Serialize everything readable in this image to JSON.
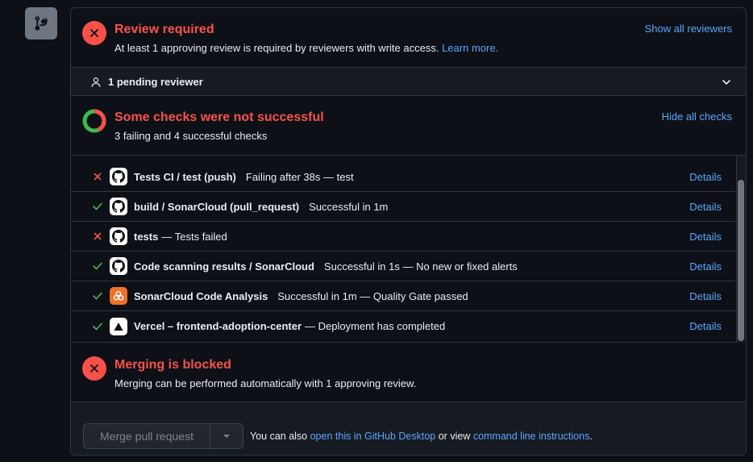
{
  "review": {
    "title": "Review required",
    "text": "At least 1 approving review is required by reviewers with write access.",
    "learn_more": "Learn more.",
    "show_all": "Show all reviewers"
  },
  "pending": {
    "label": "1 pending reviewer"
  },
  "checks": {
    "title": "Some checks were not successful",
    "summary": "3 failing and 4 successful checks",
    "hide_all": "Hide all checks",
    "items": [
      {
        "status": "fail",
        "icon": "github-icon",
        "name": "Tests CI / test (push)",
        "desc": "Failing after 38s — test",
        "details": "Details"
      },
      {
        "status": "pass",
        "icon": "github-icon",
        "name": "build / SonarCloud (pull_request)",
        "desc": "Successful in 1m",
        "details": "Details"
      },
      {
        "status": "fail",
        "icon": "github-icon",
        "name": "tests",
        "desc": "— Tests failed",
        "details": "Details"
      },
      {
        "status": "pass",
        "icon": "github-icon",
        "name": "Code scanning results / SonarCloud",
        "desc": "Successful in 1s — No new or fixed alerts",
        "details": "Details"
      },
      {
        "status": "pass",
        "icon": "sonarcloud-icon",
        "name": "SonarCloud Code Analysis",
        "desc": "Successful in 1m — Quality Gate passed",
        "details": "Details"
      },
      {
        "status": "pass",
        "icon": "vercel-icon",
        "name": "Vercel – frontend-adoption-center",
        "desc": "— Deployment has completed",
        "details": "Details"
      }
    ]
  },
  "blocked": {
    "title": "Merging is blocked",
    "text": "Merging can be performed automatically with 1 approving review."
  },
  "merge": {
    "button": "Merge pull request",
    "note_prefix": "You can also",
    "desktop_link": "open this in GitHub Desktop",
    "note_middle": "or view",
    "cli_link": "command line instructions",
    "note_suffix": "."
  },
  "colors": {
    "fail": "#f85149",
    "pass": "#3fb950",
    "link": "#58a6ff"
  }
}
